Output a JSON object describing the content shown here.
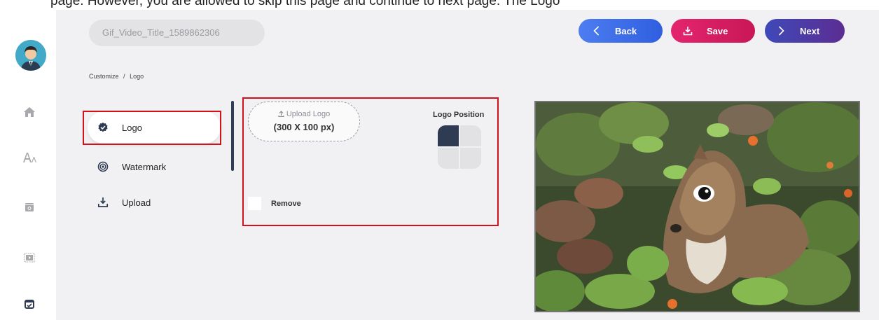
{
  "top_strip_text": "page. However, you are allowed to skip this page and continue to next page. The Logo",
  "title_field": {
    "value": "Gif_Video_Title_1589862306"
  },
  "buttons": {
    "back": "Back",
    "save": "Save",
    "next": "Next"
  },
  "breadcrumb": {
    "parent": "Customize",
    "separator": "/",
    "current": "Logo"
  },
  "menu": {
    "items": [
      {
        "label": "Logo",
        "icon": "check-badge-icon",
        "active": true
      },
      {
        "label": "Watermark",
        "icon": "target-icon",
        "active": false
      },
      {
        "label": "Upload",
        "icon": "upload-icon",
        "active": false
      }
    ]
  },
  "logo_panel": {
    "upload_label": "Upload Logo",
    "upload_size": "(300 X 100 px)",
    "position_title": "Logo Position",
    "selected_position": "top-left",
    "remove_label": "Remove"
  },
  "rail": {
    "icons": [
      "avatar",
      "home-icon",
      "text-size-icon",
      "media-card-icon",
      "video-frame-icon",
      "calendar-check-icon"
    ]
  },
  "colors": {
    "back_button": "#3d6ee8",
    "save_button": "#d81e63",
    "next_button": "#4b3ba6",
    "highlight_box": "#d4111a",
    "active_cell": "#2e3b52"
  }
}
